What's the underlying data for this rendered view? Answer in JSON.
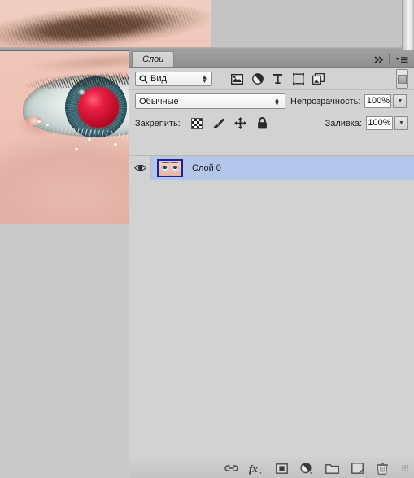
{
  "app": {
    "background_color": "#c8c8c8",
    "canvas": {
      "name": "eye-photograph",
      "description": "Close-up photograph of a human eye with red-eye effect"
    }
  },
  "panel": {
    "title": "Слои",
    "tabs": [
      {
        "label": "Слои",
        "active": true
      }
    ],
    "collapse_icon": "double-chevron-right-icon",
    "menu_icon": "panel-menu-icon",
    "filter_row": {
      "search_icon": "magnifier-icon",
      "filter_type_value": "Вид",
      "kind_icons": [
        {
          "name": "filter-pixel-layers-icon",
          "title": "image-icon"
        },
        {
          "name": "filter-adjustment-layers-icon",
          "title": "adjustment-circle-icon"
        },
        {
          "name": "filter-type-layers-icon",
          "title": "type-T-icon"
        },
        {
          "name": "filter-shape-layers-icon",
          "title": "shape-icon"
        },
        {
          "name": "filter-smart-objects-icon",
          "title": "smart-object-icon"
        }
      ],
      "toggle_name": "filter-enable-toggle"
    },
    "blend_row": {
      "blend_mode": "Обычные",
      "opacity_label": "Непрозрачность:",
      "opacity_value": "100%",
      "opacity_arrow": "chevron-down-icon"
    },
    "lock_row": {
      "lock_label": "Закрепить:",
      "lock_icons": [
        {
          "name": "lock-transparent-pixels-icon"
        },
        {
          "name": "lock-image-pixels-brush-icon"
        },
        {
          "name": "lock-position-move-icon"
        },
        {
          "name": "lock-all-padlock-icon"
        }
      ],
      "fill_label": "Заливка:",
      "fill_value": "100%",
      "fill_arrow": "chevron-down-icon"
    },
    "layers": [
      {
        "name": "Слой 0",
        "visible": true,
        "selected": true,
        "visibility_icon": "eye-icon",
        "thumbnail": "layer-thumbnail-eyes"
      }
    ],
    "bottom_toolbar": [
      {
        "name": "link-layers-icon",
        "label": "link"
      },
      {
        "name": "layer-style-fx-icon",
        "label": "fx"
      },
      {
        "name": "add-layer-mask-icon",
        "label": "mask"
      },
      {
        "name": "new-adjustment-layer-icon",
        "label": "adjustment"
      },
      {
        "name": "new-group-folder-icon",
        "label": "folder"
      },
      {
        "name": "new-layer-icon",
        "label": "new layer"
      },
      {
        "name": "delete-layer-trash-icon",
        "label": "trash"
      }
    ]
  },
  "colors": {
    "panel_bg": "#d2d2d2",
    "tabbar_bg": "#949494",
    "selection_blue": "#b4c6ea",
    "thumb_border": "#20208f",
    "red_eye": "#c8102e",
    "iris": "#33606d"
  }
}
